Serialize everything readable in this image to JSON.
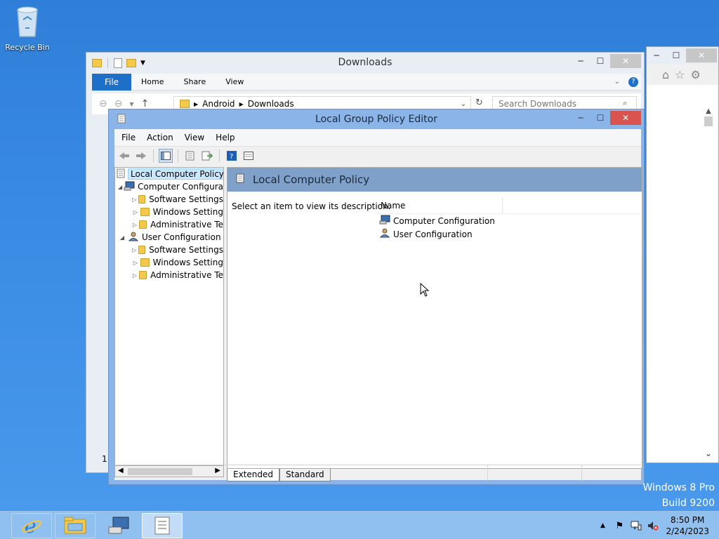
{
  "desktop": {
    "recycle_bin_label": "Recycle Bin",
    "edition_line1": "Windows 8 Pro",
    "edition_line2": "Build 9200"
  },
  "explorer": {
    "title": "Downloads",
    "ribbon_tabs": [
      "File",
      "Home",
      "Share",
      "View"
    ],
    "path": [
      "Android",
      "Downloads"
    ],
    "search_placeholder": "Search Downloads",
    "status_count": "1"
  },
  "gpe": {
    "title": "Local Group Policy Editor",
    "menu": [
      "File",
      "Action",
      "View",
      "Help"
    ],
    "tree": {
      "root": "Local Computer Policy",
      "computer": "Computer Configura",
      "computer_children": [
        "Software Settings",
        "Windows Setting",
        "Administrative Te"
      ],
      "user": "User Configuration",
      "user_children": [
        "Software Settings",
        "Windows Setting",
        "Administrative Te"
      ]
    },
    "pane_title": "Local Computer Policy",
    "description": "Select an item to view its description.",
    "column_name": "Name",
    "items": [
      "Computer Configuration",
      "User Configuration"
    ],
    "tabs": [
      "Extended",
      "Standard"
    ]
  },
  "taskbar": {
    "time": "8:50 PM",
    "date": "2/24/2023"
  }
}
